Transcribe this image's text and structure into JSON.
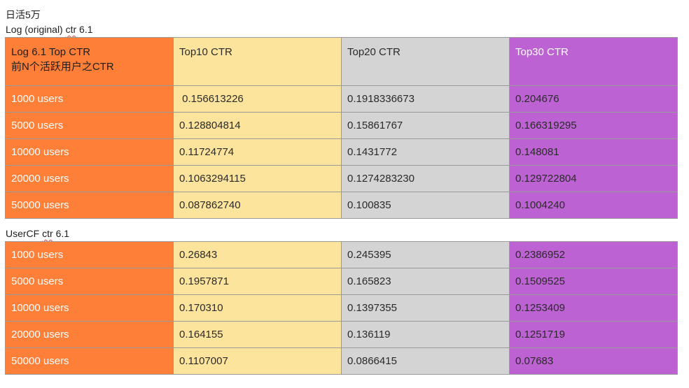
{
  "heading": {
    "line1": "日活5万",
    "line2_prefix": "Log (original) ",
    "line2_word": "ctr",
    "line2_suffix": " 6.1"
  },
  "colors": {
    "orange": "#fd7f38",
    "yellow": "#fde49c",
    "gray": "#d4d4d4",
    "purple": "#bd62d3"
  },
  "table1": {
    "header": {
      "corner_line1": "Log 6.1 Top CTR",
      "corner_line2": "前N个活跃用户之CTR",
      "col1": "Top10 CTR",
      "col2": "Top20 CTR",
      "col3": "Top30 CTR"
    },
    "rows": [
      {
        "label": "1000 users",
        "top10": " 0.156613226",
        "top20": "0.1918336673",
        "top30": "0.204676"
      },
      {
        "label": "5000 users",
        "top10": "0.128804814",
        "top20": "0.15861767",
        "top30": "0.166319295"
      },
      {
        "label": "10000 users",
        "top10": "0.11724774",
        "top20": "0.1431772",
        "top30": "0.148081"
      },
      {
        "label": "20000 users",
        "top10": "0.1063294115",
        "top20": "0.1274283230",
        "top30": "0.129722804"
      },
      {
        "label": "50000 users",
        "top10": "0.087862740",
        "top20": "0.100835",
        "top30": "0.1004240"
      }
    ]
  },
  "section2": {
    "title_prefix": "UserCF ",
    "title_word": "ctr",
    "title_suffix": " 6.1"
  },
  "table2": {
    "rows": [
      {
        "label": "1000 users",
        "top10": "0.26843",
        "top20": "0.245395",
        "top30": "0.2386952"
      },
      {
        "label": "5000 users",
        "top10": "0.1957871",
        "top20": "0.165823",
        "top30": "0.1509525"
      },
      {
        "label": "10000 users",
        "top10": "0.170310",
        "top20": "0.1397355",
        "top30": "0.1253409"
      },
      {
        "label": "20000 users",
        "top10": "0.164155",
        "top20": "0.136119",
        "top30": "0.1251719"
      },
      {
        "label": "50000 users",
        "top10": "0.1107007",
        "top20": "0.0866415",
        "top30": "0.07683"
      }
    ]
  }
}
